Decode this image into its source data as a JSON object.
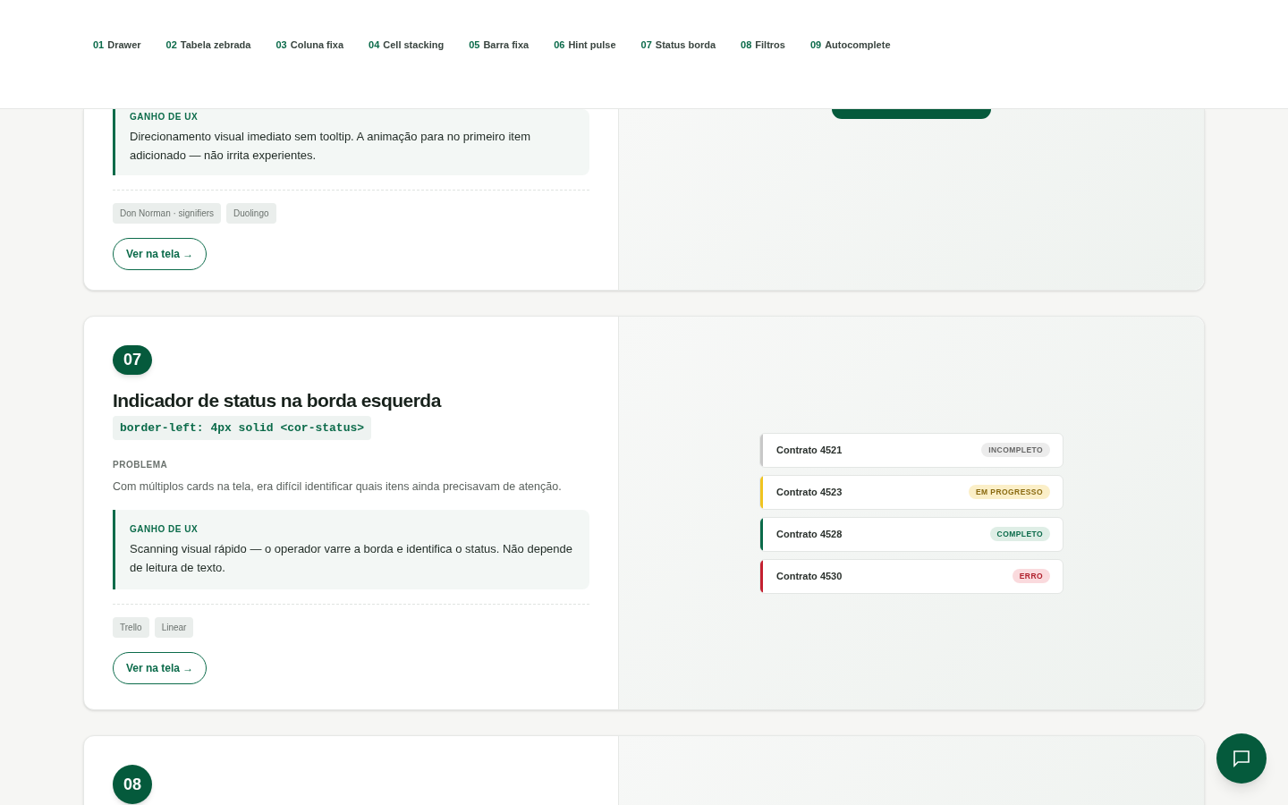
{
  "nav": [
    {
      "number": "01",
      "label": "Drawer"
    },
    {
      "number": "02",
      "label": "Tabela zebrada"
    },
    {
      "number": "03",
      "label": "Coluna fixa"
    },
    {
      "number": "04",
      "label": "Cell stacking"
    },
    {
      "number": "05",
      "label": "Barra fixa"
    },
    {
      "number": "06",
      "label": "Hint pulse"
    },
    {
      "number": "07",
      "label": "Status borda"
    },
    {
      "number": "08",
      "label": "Filtros"
    },
    {
      "number": "09",
      "label": "Autocomplete"
    }
  ],
  "cards": [
    {
      "gain_label": "GANHO DE UX",
      "gain": "Direcionamento visual imediato sem tooltip. A animação para no primeiro item adicionado — não irrita experientes.",
      "tags": [
        "Don Norman · signifiers",
        "Duolingo"
      ],
      "link": "Ver na tela →"
    },
    {
      "number": "07",
      "title": "Indicador de status na borda esquerda",
      "code": "border-left: 4px solid <cor-status>",
      "problem_label": "PROBLEMA",
      "problem": "Com múltiplos cards na tela, era difícil identificar quais itens ainda precisavam de atenção.",
      "gain_label": "GANHO DE UX",
      "gain": "Scanning visual rápido — o operador varre a borda e identifica o status. Não depende de leitura de texto.",
      "tags": [
        "Trello",
        "Linear"
      ],
      "link": "Ver na tela →",
      "demo": [
        {
          "name": "Contrato 4521",
          "status": "INCOMPLETO",
          "kind": "incomplete",
          "color": "#c8c8c8"
        },
        {
          "name": "Contrato 4523",
          "status": "EM PROGRESSO",
          "kind": "progress",
          "color": "#f0c420"
        },
        {
          "name": "Contrato 4528",
          "status": "COMPLETO",
          "kind": "complete",
          "color": "#0b6b4a"
        },
        {
          "name": "Contrato 4530",
          "status": "ERRO",
          "kind": "error",
          "color": "#c42030"
        }
      ]
    },
    {
      "number": "08"
    }
  ]
}
